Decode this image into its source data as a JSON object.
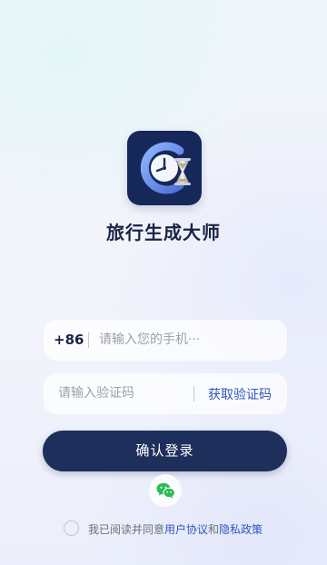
{
  "app": {
    "title": "旅行生成大师",
    "logo_icon": "clock-hourglass-icon"
  },
  "login": {
    "country_code": "+86",
    "phone_placeholder": "请输入您的手机···",
    "code_placeholder": "请输入验证码",
    "get_code_label": "获取验证码",
    "submit_label": "确认登录",
    "wechat_icon": "wechat-icon"
  },
  "agreement": {
    "prefix": "我已阅读并同意",
    "user_agreement": "用户协议",
    "connector": "和",
    "privacy_policy": "隐私政策",
    "checked": false
  },
  "colors": {
    "primary": "#1e2f5c",
    "link": "#2f56c0",
    "wechat": "#2bbd54"
  }
}
